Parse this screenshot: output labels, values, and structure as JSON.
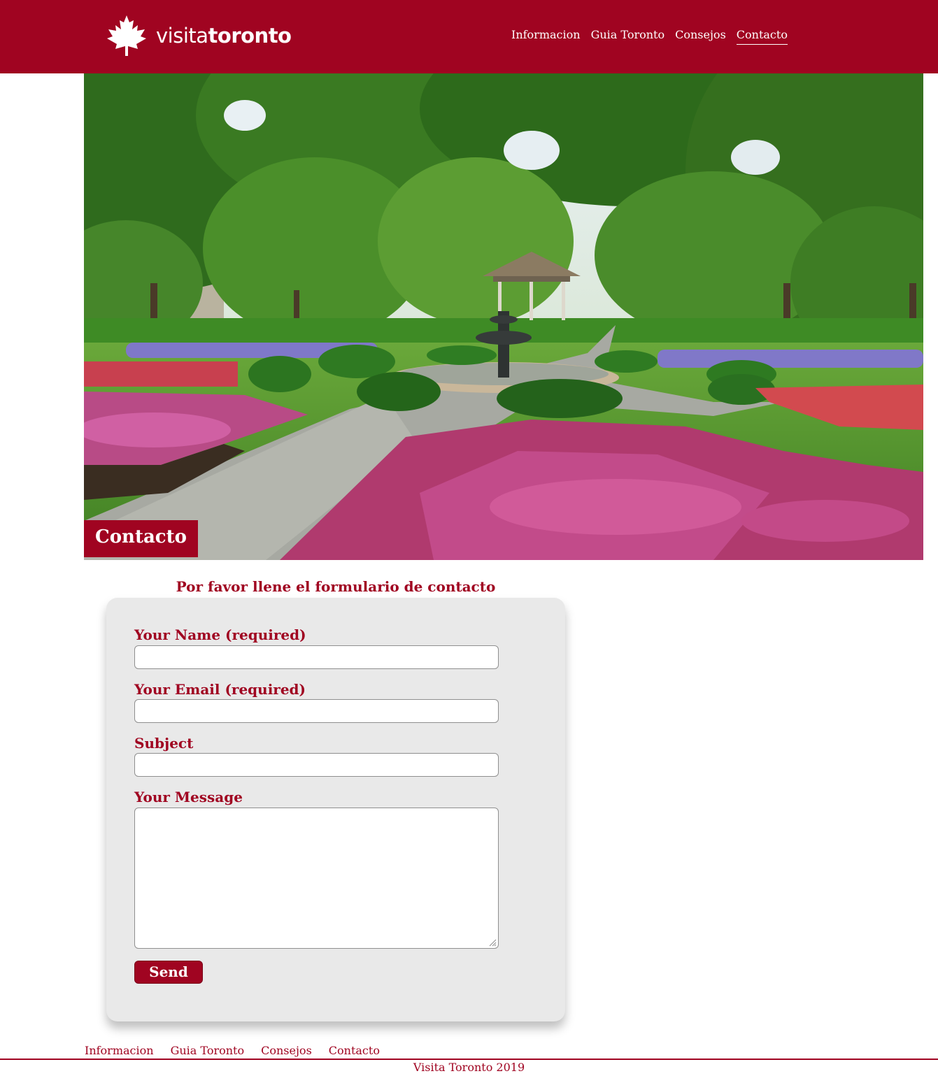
{
  "brand": {
    "logo_light": "visita",
    "logo_bold": "toronto",
    "color": "#a00421"
  },
  "nav": {
    "items": [
      {
        "label": "Informacion"
      },
      {
        "label": "Guia Toronto"
      },
      {
        "label": "Consejos"
      },
      {
        "label": "Contacto",
        "active": true
      }
    ]
  },
  "hero": {
    "title": "Contacto",
    "image": "park-garden-fountain"
  },
  "form": {
    "heading": "Por favor llene el formulario de contacto",
    "name_label": "Your Name (required)",
    "name_value": "",
    "email_label": "Your Email (required)",
    "email_value": "",
    "subject_label": "Subject",
    "subject_value": "",
    "message_label": "Your Message",
    "message_value": "",
    "send_label": "Send"
  },
  "footer": {
    "links": [
      {
        "label": "Informacion"
      },
      {
        "label": "Guia Toronto"
      },
      {
        "label": "Consejos"
      },
      {
        "label": "Contacto"
      }
    ],
    "copyright": "Visita Toronto 2019"
  }
}
